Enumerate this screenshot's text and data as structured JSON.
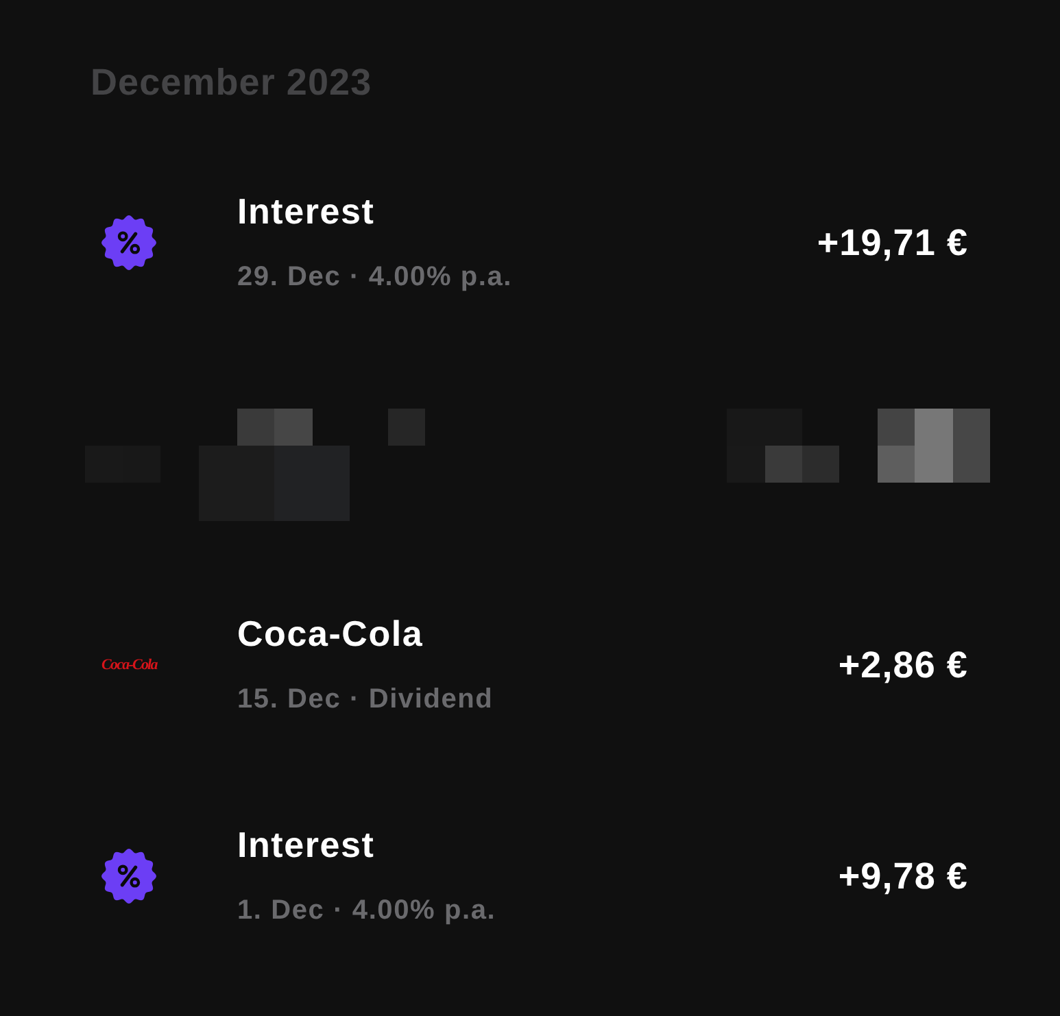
{
  "section": {
    "title": "December 2023"
  },
  "transactions": [
    {
      "kind": "interest",
      "title": "Interest",
      "subtitle": "29. Dec · 4.00% p.a.",
      "amount": "+19,71 €"
    },
    {
      "kind": "redacted"
    },
    {
      "kind": "stock",
      "logo": "Coca-Cola",
      "title": "Coca-Cola",
      "subtitle": "15. Dec · Dividend",
      "amount": "+2,86 €"
    },
    {
      "kind": "interest",
      "title": "Interest",
      "subtitle": "1. Dec · 4.00% p.a.",
      "amount": "+9,78 €"
    }
  ]
}
